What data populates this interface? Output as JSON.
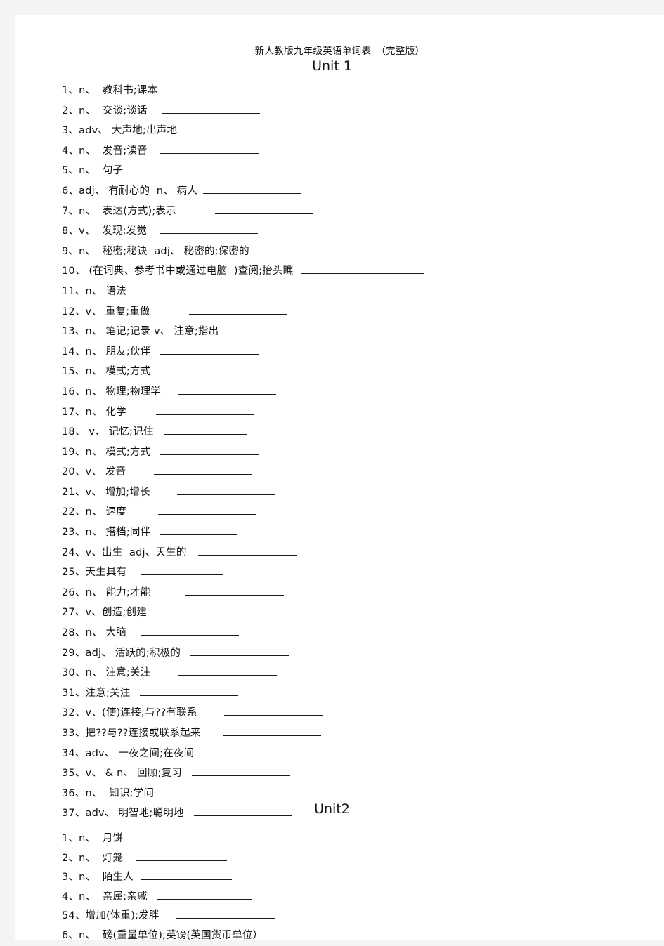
{
  "document": {
    "title": "新人教版九年级英语单词表　（完整版）"
  },
  "units": [
    {
      "heading": "Unit 1",
      "items": [
        {
          "text": "1、n、  教科书;课本",
          "gap": 14,
          "blank": 212
        },
        {
          "text": "2、n、  交谈;谈话",
          "gap": 20,
          "blank": 140
        },
        {
          "text": "3、adv、 大声地;出声地",
          "gap": 15,
          "blank": 140
        },
        {
          "text": "4、n、  发音;读音",
          "gap": 18,
          "blank": 140
        },
        {
          "text": "5、n、  句子",
          "gap": 50,
          "blank": 140
        },
        {
          "text": "6、adj、 有耐心的  n、 病人",
          "gap": 8,
          "blank": 140
        },
        {
          "text": "7、n、  表达(方式);表示",
          "gap": 55,
          "blank": 140
        },
        {
          "text": "8、v、  发现;发觉",
          "gap": 18,
          "blank": 140
        },
        {
          "text": "9、n、  秘密;秘诀  adj、 秘密的;保密的",
          "gap": 8,
          "blank": 140
        },
        {
          "text": "10、 (在词典、参考书中或通过电脑  )查阅;抬头瞧",
          "gap": 12,
          "blank": 175
        },
        {
          "text": "11、n、 语法",
          "gap": 48,
          "blank": 140
        },
        {
          "text": "12、v、 重复;重做",
          "gap": 55,
          "blank": 140
        },
        {
          "text": "13、n、 笔记;记录 v、 注意;指出",
          "gap": 16,
          "blank": 140
        },
        {
          "text": "14、n、 朋友;伙伴",
          "gap": 14,
          "blank": 140
        },
        {
          "text": "15、n、 模式;方式",
          "gap": 14,
          "blank": 140
        },
        {
          "text": "16、n、 物理;物理学",
          "gap": 24,
          "blank": 140
        },
        {
          "text": "17、n、 化学",
          "gap": 42,
          "blank": 140
        },
        {
          "text": "18、 v、 记忆;记住",
          "gap": 14,
          "blank": 118
        },
        {
          "text": "19、n、 模式;方式",
          "gap": 14,
          "blank": 140
        },
        {
          "text": "20、v、 发音",
          "gap": 40,
          "blank": 140
        },
        {
          "text": "21、v、 增加;增长",
          "gap": 38,
          "blank": 140
        },
        {
          "text": "22、n、 速度",
          "gap": 45,
          "blank": 140
        },
        {
          "text": "23、n、 搭档;同伴",
          "gap": 14,
          "blank": 110
        },
        {
          "text": "24、v、出生  adj、天生的",
          "gap": 16,
          "blank": 140
        },
        {
          "text": "25、天生具有",
          "gap": 20,
          "blank": 118
        },
        {
          "text": "26、n、 能力;才能",
          "gap": 50,
          "blank": 140
        },
        {
          "text": "27、v、创造;创建",
          "gap": 14,
          "blank": 125
        },
        {
          "text": "28、n、 大脑",
          "gap": 20,
          "blank": 140
        },
        {
          "text": "29、adj、 活跃的;积极的",
          "gap": 14,
          "blank": 140
        },
        {
          "text": "30、n、 注意;关注",
          "gap": 40,
          "blank": 140
        },
        {
          "text": "31、注意;关注",
          "gap": 14,
          "blank": 140
        },
        {
          "text": "32、v、(使)连接;与??有联系",
          "gap": 38,
          "blank": 140
        },
        {
          "text": "33、把??与??连接或联系起来",
          "gap": 32,
          "blank": 140
        },
        {
          "text": "34、adv、 一夜之间;在夜间",
          "gap": 14,
          "blank": 140
        },
        {
          "text": "35、v、 & n、 回顾;复习",
          "gap": 14,
          "blank": 140
        },
        {
          "text": "36、n、  知识;学问",
          "gap": 50,
          "blank": 140
        },
        {
          "text": "37、adv、 明智地;聪明地",
          "gap": 14,
          "blank": 140
        }
      ]
    },
    {
      "heading": "Unit2",
      "items": [
        {
          "text": "1、n、  月饼",
          "gap": 8,
          "blank": 118
        },
        {
          "text": "2、n、  灯笼",
          "gap": 18,
          "blank": 130
        },
        {
          "text": "3、n、  陌生人",
          "gap": 10,
          "blank": 130
        },
        {
          "text": "4、n、  亲属;亲戚",
          "gap": 14,
          "blank": 135
        },
        {
          "text": "54、增加(体重);发胖",
          "gap": 24,
          "blank": 140
        },
        {
          "text": "6、n、  磅(重量单位);英镑(英国货币单位）",
          "gap": 24,
          "blank": 140
        }
      ]
    }
  ]
}
